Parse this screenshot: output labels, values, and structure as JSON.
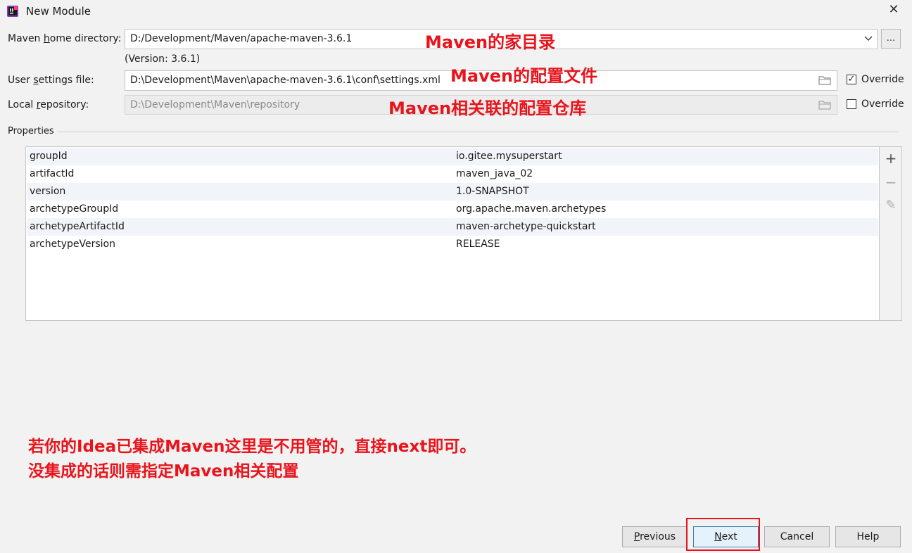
{
  "window": {
    "title": "New Module",
    "close_glyph": "✕"
  },
  "form": {
    "maven_home": {
      "label_pre": "Maven ",
      "label_mn": "h",
      "label_post": "ome directory:",
      "value": "D:/Development/Maven/apache-maven-3.6.1",
      "version_text": "(Version: 3.6.1)",
      "browse_label": "..."
    },
    "user_settings": {
      "label_pre": "User ",
      "label_mn": "s",
      "label_post": "ettings file:",
      "value": "D:\\Development\\Maven\\apache-maven-3.6.1\\conf\\settings.xml",
      "override_label": "Override",
      "override_checked": true
    },
    "local_repo": {
      "label_pre": "Local ",
      "label_mn": "r",
      "label_post": "epository:",
      "value": "D:\\Development\\Maven\\repository",
      "override_label": "Override",
      "override_checked": false
    }
  },
  "annotations": {
    "home": "Maven的家目录",
    "settings": "Maven的配置文件",
    "repo": "Maven相关联的配置仓库",
    "note_line1": "若你的Idea已集成Maven这里是不用管的，直接next即可。",
    "note_line2": "没集成的话则需指定Maven相关配置"
  },
  "properties": {
    "section_label": "Properties",
    "rows": [
      {
        "key": "groupId",
        "value": "io.gitee.mysuperstart"
      },
      {
        "key": "artifactId",
        "value": "maven_java_02"
      },
      {
        "key": "version",
        "value": "1.0-SNAPSHOT"
      },
      {
        "key": "archetypeGroupId",
        "value": "org.apache.maven.archetypes"
      },
      {
        "key": "archetypeArtifactId",
        "value": "maven-archetype-quickstart"
      },
      {
        "key": "archetypeVersion",
        "value": "RELEASE"
      }
    ],
    "tools": {
      "add": "+",
      "remove": "−",
      "edit": "✎"
    }
  },
  "footer": {
    "previous_mn": "P",
    "previous_rest": "revious",
    "next_mn": "N",
    "next_rest": "ext",
    "cancel": "Cancel",
    "help": "Help"
  },
  "colors": {
    "annotation": "#e8141c",
    "primary_border": "#3c7fb1"
  },
  "icons": {
    "app": "intellij-icon",
    "dropdown": "chevron-down-icon",
    "folder": "folder-icon"
  }
}
